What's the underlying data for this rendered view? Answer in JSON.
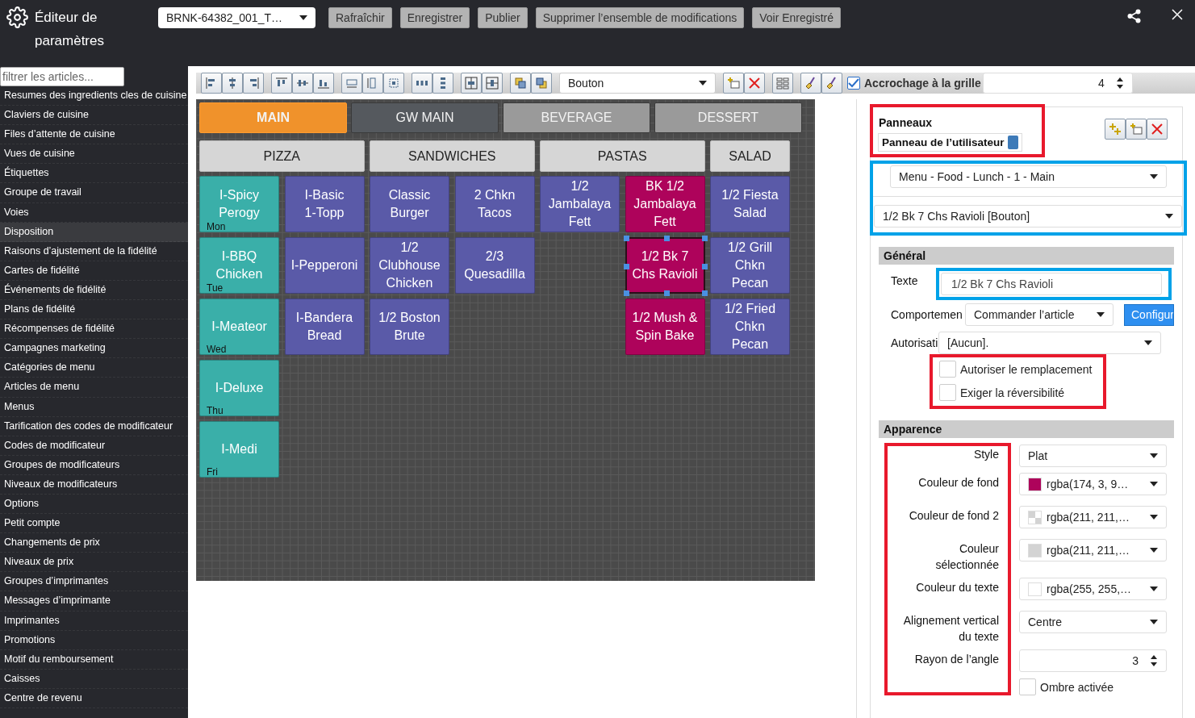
{
  "header": {
    "title": "Éditeur de paramètres",
    "project_select": "BRNK-64382_001_T…",
    "buttons": [
      "Rafraîchir",
      "Enregistrer",
      "Publier",
      "Supprimer l’ensemble de modifications",
      "Voir Enregistré"
    ]
  },
  "sidebar": {
    "filter_placeholder": "filtrer les articles...",
    "items": [
      {
        "label": "Resumes des ingredients cles de cuisine",
        "selected": false
      },
      {
        "label": "Claviers de cuisine",
        "selected": false
      },
      {
        "label": "Files d’attente de cuisine",
        "selected": false
      },
      {
        "label": "Vues de cuisine",
        "selected": false
      },
      {
        "label": "Étiquettes",
        "selected": false
      },
      {
        "label": "Groupe de travail",
        "selected": false
      },
      {
        "label": "Voies",
        "selected": false
      },
      {
        "label": "Disposition",
        "selected": true
      },
      {
        "label": "Raisons d’ajustement de la fidélité",
        "selected": false
      },
      {
        "label": "Cartes de fidélité",
        "selected": false
      },
      {
        "label": "Événements de fidélité",
        "selected": false
      },
      {
        "label": "Plans de fidélité",
        "selected": false
      },
      {
        "label": "Récompenses de fidélité",
        "selected": false
      },
      {
        "label": "Campagnes marketing",
        "selected": false
      },
      {
        "label": "Catégories de menu",
        "selected": false
      },
      {
        "label": "Articles de menu",
        "selected": false
      },
      {
        "label": "Menus",
        "selected": false
      },
      {
        "label": "Tarification des codes de modificateur",
        "selected": false
      },
      {
        "label": "Codes de modificateur",
        "selected": false
      },
      {
        "label": "Groupes de modificateurs",
        "selected": false
      },
      {
        "label": "Niveaux de modificateurs",
        "selected": false
      },
      {
        "label": "Options",
        "selected": false
      },
      {
        "label": "Petit compte",
        "selected": false
      },
      {
        "label": "Changements de prix",
        "selected": false
      },
      {
        "label": "Niveaux de prix",
        "selected": false
      },
      {
        "label": "Groupes d’imprimantes",
        "selected": false
      },
      {
        "label": "Messages d’imprimante",
        "selected": false
      },
      {
        "label": "Imprimantes",
        "selected": false
      },
      {
        "label": "Promotions",
        "selected": false
      },
      {
        "label": "Motif du remboursement",
        "selected": false
      },
      {
        "label": "Caisses",
        "selected": false
      },
      {
        "label": "Centre de revenu",
        "selected": false
      }
    ]
  },
  "toolbar": {
    "element_type": "Bouton",
    "snap_to_grid": {
      "label": "Accrochage à la grille",
      "checked": true
    },
    "grid_size": "4"
  },
  "canvas": {
    "panel_tabs": [
      {
        "label": "MAIN",
        "color": "#f0922b",
        "selected": true
      },
      {
        "label": "GW MAIN",
        "color": "#55595e",
        "selected": false
      },
      {
        "label": "BEVERAGE",
        "color": "#9a9a9a",
        "selected": false
      },
      {
        "label": "DESSERT",
        "color": "#9a9a9a",
        "selected": false
      }
    ],
    "categories": [
      "PIZZA",
      "SANDWICHES",
      "PASTAS",
      "SALAD"
    ],
    "rows": [
      {
        "cells": [
          {
            "kind": "button",
            "label": "I-Spicy\nPerogy",
            "day": "Mon",
            "color": "#3aafa9",
            "selected": false
          },
          {
            "kind": "button",
            "label": "I-Basic\n1-Topp",
            "color": "#5a5aa8",
            "selected": false
          },
          {
            "kind": "button",
            "label": "Classic\nBurger",
            "color": "#5a5aa8",
            "selected": false
          },
          {
            "kind": "button",
            "label": "2 Chkn\nTacos",
            "color": "#5a5aa8",
            "selected": false
          },
          {
            "kind": "button",
            "label": "1/2\nJambalaya\nFett",
            "color": "#5a5aa8",
            "selected": false
          },
          {
            "kind": "button",
            "label": "BK 1/2\nJambalaya\nFett",
            "color": "#ae035b",
            "selected": false
          },
          {
            "kind": "button",
            "label": "1/2 Fiesta\nSalad",
            "color": "#5a5aa8",
            "selected": false
          }
        ]
      },
      {
        "cells": [
          {
            "kind": "button",
            "label": "I-BBQ\nChicken",
            "day": "Tue",
            "color": "#3aafa9",
            "selected": false
          },
          {
            "kind": "button",
            "label": "I-Pepperoni",
            "color": "#5a5aa8",
            "selected": false
          },
          {
            "kind": "button",
            "label": "1/2\nClubhouse\nChicken",
            "color": "#5a5aa8",
            "selected": false
          },
          {
            "kind": "button",
            "label": "2/3\nQuesadilla",
            "color": "#5a5aa8",
            "selected": false
          },
          {
            "kind": "empty"
          },
          {
            "kind": "button",
            "label": "1/2 Bk 7\nChs Ravioli",
            "color": "#ae035b",
            "selected": true
          },
          {
            "kind": "button",
            "label": "1/2 Grill\nChkn\nPecan",
            "color": "#5a5aa8",
            "selected": false
          }
        ]
      },
      {
        "cells": [
          {
            "kind": "button",
            "label": "I-Meateor",
            "day": "Wed",
            "color": "#3aafa9",
            "selected": false
          },
          {
            "kind": "button",
            "label": "I-Bandera\nBread",
            "color": "#5a5aa8",
            "selected": false
          },
          {
            "kind": "button",
            "label": "1/2 Boston\nBrute",
            "color": "#5a5aa8",
            "selected": false
          },
          {
            "kind": "empty"
          },
          {
            "kind": "empty"
          },
          {
            "kind": "button",
            "label": "1/2 Mush &\nSpin Bake",
            "color": "#ae035b",
            "selected": false
          },
          {
            "kind": "button",
            "label": "1/2 Fried\nChkn\nPecan",
            "color": "#5a5aa8",
            "selected": false
          }
        ]
      },
      {
        "cells": [
          {
            "kind": "button",
            "label": "I-Deluxe",
            "day": "Thu",
            "color": "#3aafa9",
            "selected": false
          }
        ]
      },
      {
        "cells": [
          {
            "kind": "button",
            "label": "I-Medi",
            "day": "Fri",
            "color": "#3aafa9",
            "selected": false
          }
        ]
      }
    ]
  },
  "properties": {
    "panels": {
      "title": "Panneaux",
      "current": "Panneau de l’utilisateur"
    },
    "menu_select": "Menu - Food - Lunch - 1 - Main",
    "element_select": "1/2 Bk 7 Chs Ravioli [Bouton]",
    "general": {
      "title": "Général",
      "text_label": "Texte",
      "text_value": "1/2 Bk 7 Chs Ravioli",
      "behavior_label": "Comportemen",
      "behavior_value": "Commander l’article",
      "configure_button": "Configur",
      "authorization_label": "Autorisati",
      "authorization_value": "[Aucun].",
      "checkboxes": [
        {
          "label": "Autoriser le remplacement",
          "checked": false
        },
        {
          "label": "Exiger la réversibilité",
          "checked": false
        }
      ]
    },
    "appearance": {
      "title": "Apparence",
      "fields": [
        {
          "kind": "select",
          "label": "Style",
          "value": "Plat"
        },
        {
          "kind": "color",
          "label": "Couleur de fond",
          "value": "rgba(174, 3, 9…",
          "color": "#ae035b"
        },
        {
          "kind": "transparent_color",
          "label": "Couleur de fond 2",
          "value": "rgba(211, 211,…",
          "color": "#d3d3d3"
        },
        {
          "kind": "color",
          "label": "Couleur sélectionnée",
          "value": "rgba(211, 211,…",
          "color": "#d3d3d3"
        },
        {
          "kind": "color",
          "label": "Couleur du texte",
          "value": "rgba(255, 255,…",
          "color": "#ffffff"
        },
        {
          "kind": "select",
          "label": "Alignement vertical du texte",
          "value": "Centre"
        },
        {
          "kind": "number",
          "label": "Rayon de l’angle",
          "value": "3"
        }
      ],
      "shadow": {
        "label": "Ombre activée",
        "checked": false
      }
    }
  }
}
